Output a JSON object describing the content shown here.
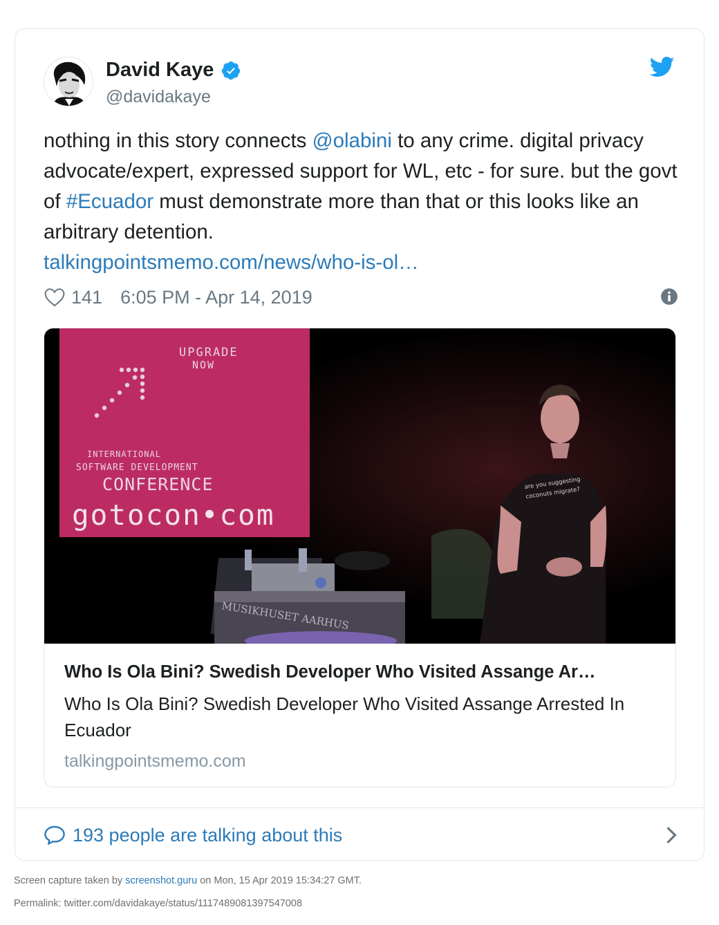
{
  "tweet": {
    "author": {
      "display_name": "David Kaye",
      "handle": "@davidakaye",
      "verified": true,
      "avatar_icon": "avatar-portrait"
    },
    "text_segments": [
      {
        "text": "nothing in this story connects ",
        "type": "plain"
      },
      {
        "text": "@olabini",
        "type": "mention"
      },
      {
        "text": " to any crime. digital privacy advocate/expert, expressed support for WL, etc - for sure. but the govt of ",
        "type": "plain"
      },
      {
        "text": "#Ecuador",
        "type": "hashtag"
      },
      {
        "text": " must demonstrate more than that or this looks like an arbitrary detention.",
        "type": "plain"
      }
    ],
    "url_text": "talkingpointsmemo.com/news/who-is-ol…",
    "likes": "141",
    "timestamp": "6:05 PM - Apr 14, 2019",
    "link_color": "#2b7bb9"
  },
  "link_card": {
    "image": {
      "banner_line1": "UPGRADE",
      "banner_line2": "NOW",
      "banner_line3": "INTERNATIONAL",
      "banner_line4": "SOFTWARE DEVELOPMENT",
      "banner_line5": "CONFERENCE",
      "banner_line6": "gotocon•com",
      "podium_text": "MUSIKHUSET AARHUS",
      "shirt_line1": "are you suggesting",
      "shirt_line2": "coconuts migrate?"
    },
    "title": "Who Is Ola Bini? Swedish Developer Who Visited Assange Ar…",
    "description": "Who Is Ola Bini? Swedish Developer Who Visited Assange Arrested In Ecuador",
    "domain": "talkingpointsmemo.com"
  },
  "conversation": {
    "label": "193 people are talking about this"
  },
  "footer": {
    "capture_prefix": "Screen capture taken by ",
    "capture_link": "screenshot.guru",
    "capture_suffix": " on Mon, 15 Apr 2019 15:34:27 GMT.",
    "permalink": "Permalink: twitter.com/davidakaye/status/1117489081397547008"
  }
}
